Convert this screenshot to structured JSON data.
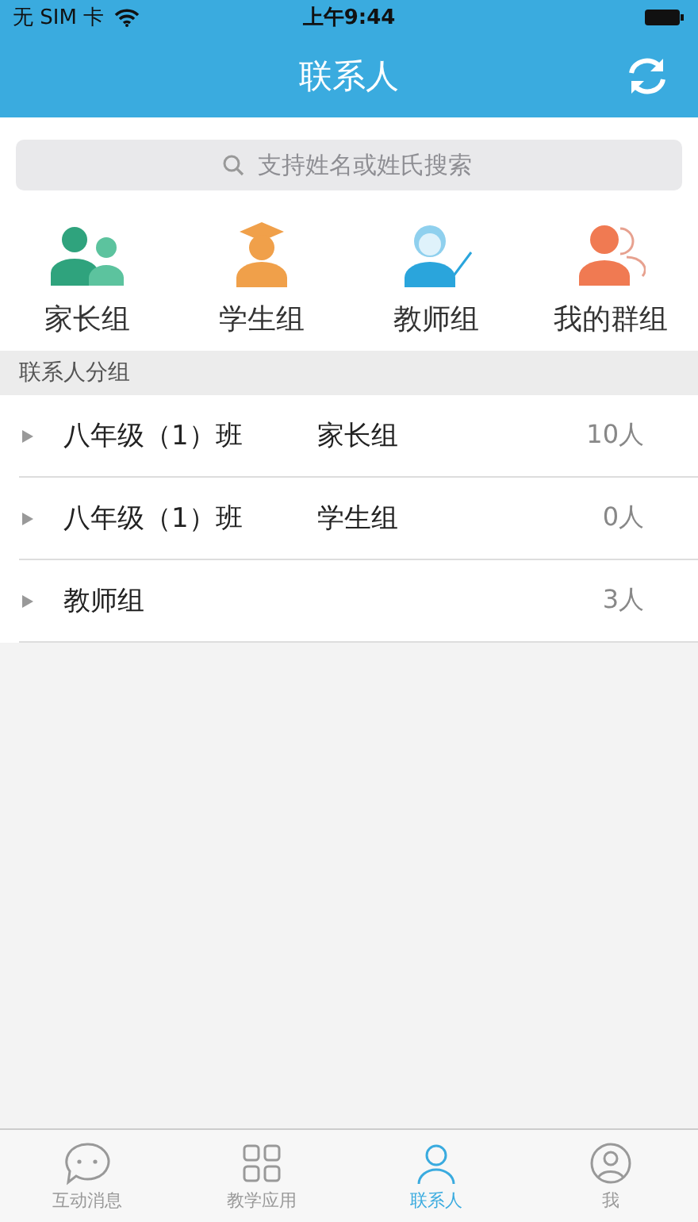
{
  "status_bar": {
    "carrier": "无 SIM 卡",
    "time": "上午9:44"
  },
  "nav_bar": {
    "title": "联系人"
  },
  "search": {
    "placeholder": "支持姓名或姓氏搜索"
  },
  "quick_groups": [
    {
      "kind": "parents",
      "label": "家长组"
    },
    {
      "kind": "students",
      "label": "学生组"
    },
    {
      "kind": "teachers",
      "label": "教师组"
    },
    {
      "kind": "mine",
      "label": "我的群组"
    }
  ],
  "section_header": "联系人分组",
  "groups": [
    {
      "name": "八年级（1）班",
      "subgroup": "家长组",
      "count": "10人",
      "expanded": false
    },
    {
      "name": "八年级（1）班",
      "subgroup": "学生组",
      "count": "0人",
      "expanded": false
    },
    {
      "name": "教师组",
      "count": "3人",
      "expanded": false
    }
  ],
  "tabs": [
    {
      "kind": "chat",
      "label": "互动消息",
      "selected": false
    },
    {
      "kind": "apps",
      "label": "教学应用",
      "selected": false
    },
    {
      "kind": "contacts",
      "label": "联系人",
      "selected": true
    },
    {
      "kind": "me",
      "label": "我",
      "selected": false
    }
  ]
}
